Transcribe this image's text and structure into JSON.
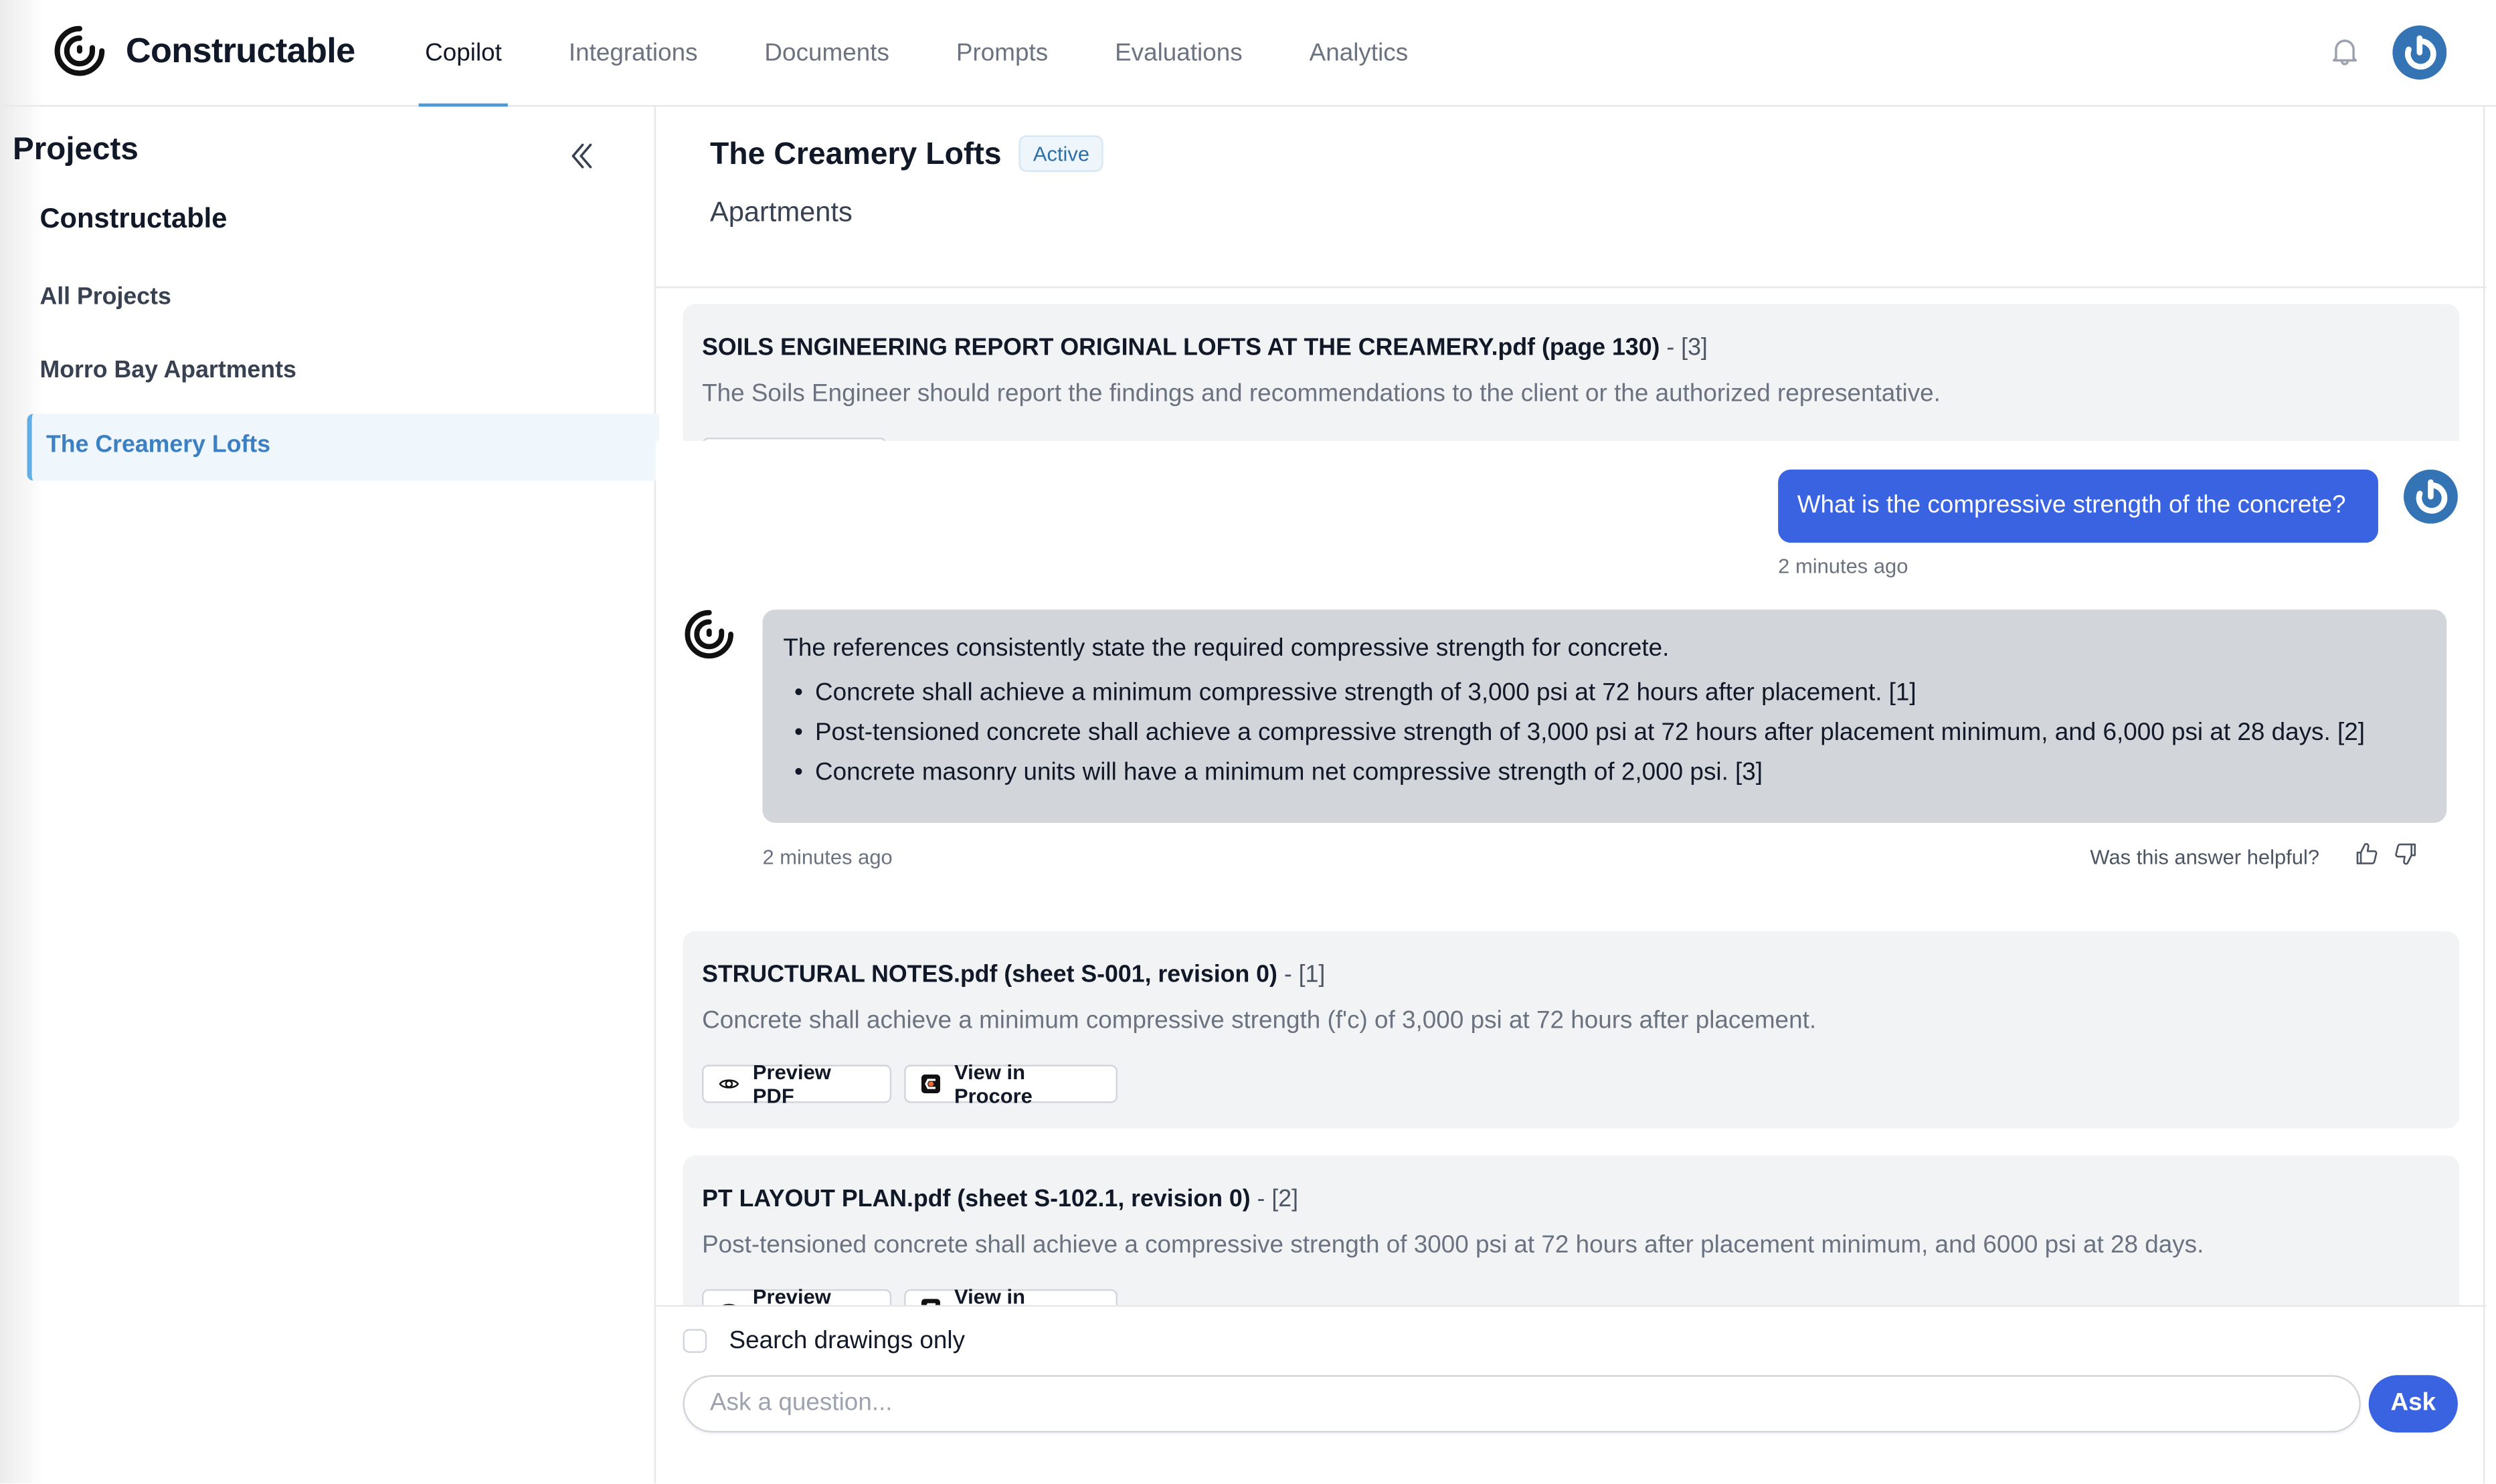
{
  "app": {
    "brand_name": "Constructable",
    "accent_color": "#4a9ad8",
    "primary_button_color": "#3a63e2"
  },
  "nav": {
    "items": [
      {
        "label": "Copilot",
        "active": true
      },
      {
        "label": "Integrations",
        "active": false
      },
      {
        "label": "Documents",
        "active": false
      },
      {
        "label": "Prompts",
        "active": false
      },
      {
        "label": "Evaluations",
        "active": false
      },
      {
        "label": "Analytics",
        "active": false
      }
    ],
    "icons": [
      "bell-icon",
      "user-avatar-icon"
    ]
  },
  "sidebar": {
    "title": "Projects",
    "collapse_icon": "double-chevron-left-icon",
    "organization": "Constructable",
    "items": [
      {
        "label": "All Projects",
        "active": false
      },
      {
        "label": "Morro Bay Apartments",
        "active": false
      },
      {
        "label": "The Creamery Lofts",
        "active": true
      }
    ]
  },
  "project": {
    "title": "The Creamery Lofts",
    "status_badge": "Active",
    "subtitle": "Apartments"
  },
  "chat": {
    "previous_citation": {
      "title": "SOILS ENGINEERING REPORT ORIGINAL LOFTS AT THE CREAMERY.pdf (page 130)",
      "ref": " - [3]",
      "excerpt": "The Soils Engineer should report the findings and recommendations to the client or the authorized representative."
    },
    "user_message": {
      "text": "What is the compressive strength of the concrete?",
      "timestamp": "2 minutes ago"
    },
    "answer": {
      "intro": "The references consistently state the required compressive strength for concrete.",
      "bullets": [
        "Concrete shall achieve a minimum compressive strength of 3,000 psi at 72 hours after placement. [1]",
        "Post-tensioned concrete shall achieve a compressive strength of 3,000 psi at 72 hours after placement minimum, and 6,000 psi at 28 days. [2]",
        "Concrete masonry units will have a minimum net compressive strength of 2,000 psi. [3]"
      ],
      "timestamp": "2 minutes ago",
      "feedback_prompt": "Was this answer helpful?"
    },
    "citations": [
      {
        "title": "STRUCTURAL NOTES.pdf (sheet S-001, revision 0)",
        "ref": " - [1]",
        "excerpt": "Concrete shall achieve a minimum compressive strength (f'c) of 3,000 psi at 72 hours after placement.",
        "preview_label": "Preview PDF",
        "procore_label": "View in Procore"
      },
      {
        "title": "PT LAYOUT PLAN.pdf (sheet S-102.1, revision 0)",
        "ref": " - [2]",
        "excerpt": "Post-tensioned concrete shall achieve a compressive strength of 3000 psi at 72 hours after placement minimum, and 6000 psi at 28 days.",
        "preview_label": "Preview PDF",
        "procore_label": "View in Procore"
      }
    ]
  },
  "composer": {
    "checkbox_label": "Search drawings only",
    "checkbox_checked": false,
    "input_value": "",
    "input_placeholder": "Ask a question...",
    "ask_label": "Ask"
  }
}
